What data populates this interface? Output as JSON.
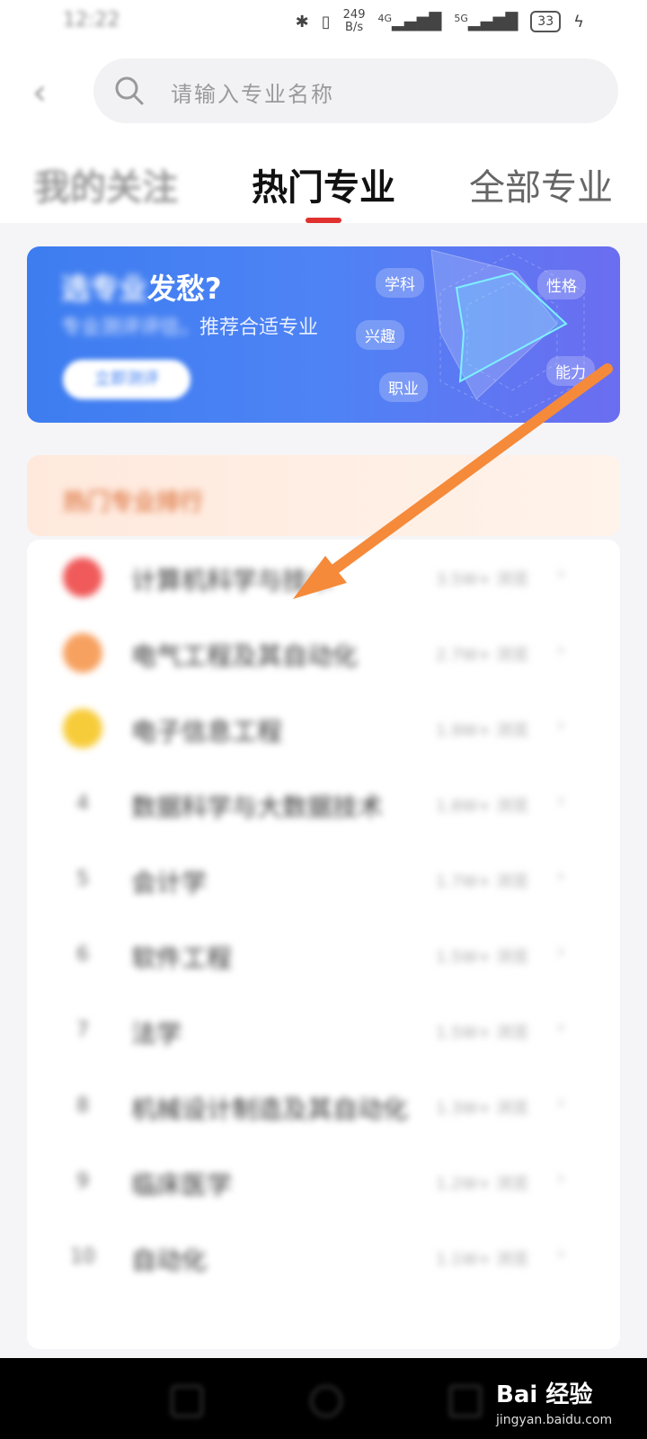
{
  "status_bar": {
    "time": "12:22",
    "net_speed_value": "249",
    "net_speed_unit": "B/s",
    "sig1_label": "4G",
    "sig2_label": "5G",
    "battery": "33"
  },
  "search": {
    "placeholder": "请输入专业名称"
  },
  "tabs": [
    {
      "label": "我的关注",
      "active": false
    },
    {
      "label": "热门专业",
      "active": true
    },
    {
      "label": "全部专业",
      "active": false
    }
  ],
  "banner": {
    "title_blurred": "选专业",
    "title_visible": "发愁?",
    "subtitle_blurred": "专业测评评估，",
    "subtitle_visible": "推荐合适专业",
    "button_label": "立即测评",
    "radar_tags": [
      "学科",
      "性格",
      "兴趣",
      "能力",
      "职业"
    ],
    "colors": {
      "start": "#3d7df0",
      "end": "#6b6df0"
    }
  },
  "section": {
    "title": "热门专业排行"
  },
  "ranking": [
    {
      "rank": "1",
      "name": "计算机科学与技术",
      "value": "3.5W+ 浏览",
      "color": "#f05a5a"
    },
    {
      "rank": "2",
      "name": "电气工程及其自动化",
      "value": "2.7W+ 浏览",
      "color": "#f7a160"
    },
    {
      "rank": "3",
      "name": "电子信息工程",
      "value": "1.9W+ 浏览",
      "color": "#f7cc3a"
    },
    {
      "rank": "4",
      "name": "数据科学与大数据技术",
      "value": "1.8W+ 浏览",
      "color": ""
    },
    {
      "rank": "5",
      "name": "会计学",
      "value": "1.7W+ 浏览",
      "color": ""
    },
    {
      "rank": "6",
      "name": "软件工程",
      "value": "1.5W+ 浏览",
      "color": ""
    },
    {
      "rank": "7",
      "name": "法学",
      "value": "1.5W+ 浏览",
      "color": ""
    },
    {
      "rank": "8",
      "name": "机械设计制造及其自动化",
      "value": "1.3W+ 浏览",
      "color": ""
    },
    {
      "rank": "9",
      "name": "临床医学",
      "value": "1.2W+ 浏览",
      "color": ""
    },
    {
      "rank": "10",
      "name": "自动化",
      "value": "1.1W+ 浏览",
      "color": ""
    }
  ],
  "watermark": {
    "brand": "Bai 经验",
    "url": "jingyan.baidu.com"
  },
  "annotation_color": "#f58a3a"
}
